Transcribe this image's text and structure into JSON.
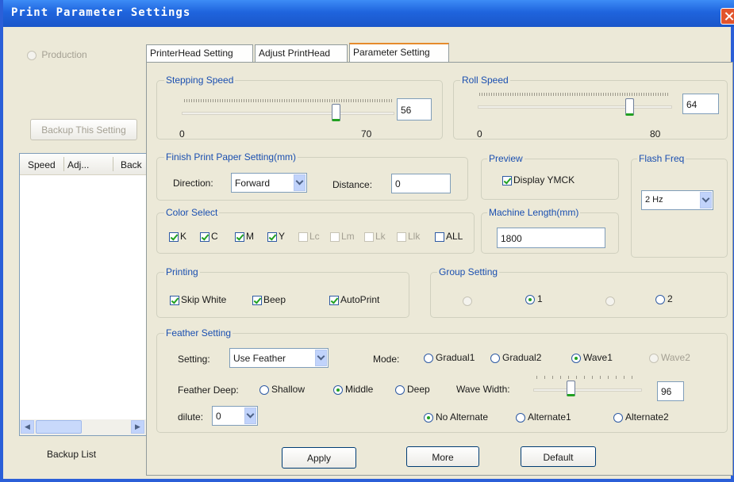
{
  "window": {
    "title": "Print Parameter Settings"
  },
  "left_panel": {
    "production_label": "Production",
    "backup_button": "Backup This Setting",
    "list_columns": [
      "Speed",
      "Adj...",
      "Back"
    ],
    "footer_label": "Backup List"
  },
  "tabs": [
    {
      "label": "PrinterHead Setting",
      "active": false
    },
    {
      "label": "Adjust PrintHead",
      "active": false
    },
    {
      "label": "Parameter Setting",
      "active": true
    }
  ],
  "stepping_speed": {
    "label": "Stepping Speed",
    "value": "56",
    "min": "0",
    "max": "70"
  },
  "roll_speed": {
    "label": "Roll Speed",
    "value": "64",
    "min": "0",
    "max": "80"
  },
  "finish_print": {
    "label": "Finish Print Paper Setting(mm)",
    "direction_label": "Direction:",
    "direction_value": "Forward",
    "distance_label": "Distance:",
    "distance_value": "0"
  },
  "preview": {
    "label": "Preview",
    "checkbox_label": "Display YMCK"
  },
  "flash_freq": {
    "label": "Flash Freq",
    "value": "2 Hz"
  },
  "color_select": {
    "label": "Color Select",
    "items": [
      {
        "label": "K",
        "checked": true,
        "enabled": true
      },
      {
        "label": "C",
        "checked": true,
        "enabled": true
      },
      {
        "label": "M",
        "checked": true,
        "enabled": true
      },
      {
        "label": "Y",
        "checked": true,
        "enabled": true
      },
      {
        "label": "Lc",
        "checked": false,
        "enabled": false
      },
      {
        "label": "Lm",
        "checked": false,
        "enabled": false
      },
      {
        "label": "Lk",
        "checked": false,
        "enabled": false
      },
      {
        "label": "Llk",
        "checked": false,
        "enabled": false
      },
      {
        "label": "ALL",
        "checked": false,
        "enabled": true
      }
    ]
  },
  "machine_length": {
    "label": "Machine Length(mm)",
    "value": "1800"
  },
  "printing": {
    "label": "Printing",
    "skip_white": "Skip White",
    "beep": "Beep",
    "autoprint": "AutoPrint"
  },
  "group_setting": {
    "label": "Group Setting",
    "opt1": "1",
    "opt2": "2"
  },
  "feather": {
    "label": "Feather Setting",
    "setting_label": "Setting:",
    "setting_value": "Use Feather",
    "mode_label": "Mode:",
    "modes": [
      "Gradual1",
      "Gradual2",
      "Wave1",
      "Wave2"
    ],
    "deep_label": "Feather Deep:",
    "deeps": [
      "Shallow",
      "Middle",
      "Deep"
    ],
    "wave_width_label": "Wave Width:",
    "wave_width_value": "96",
    "dilute_label": "dilute:",
    "dilute_value": "0",
    "alternates": [
      "No Alternate",
      "Alternate1",
      "Alternate2"
    ]
  },
  "buttons": {
    "apply": "Apply",
    "more": "More",
    "default": "Default"
  }
}
